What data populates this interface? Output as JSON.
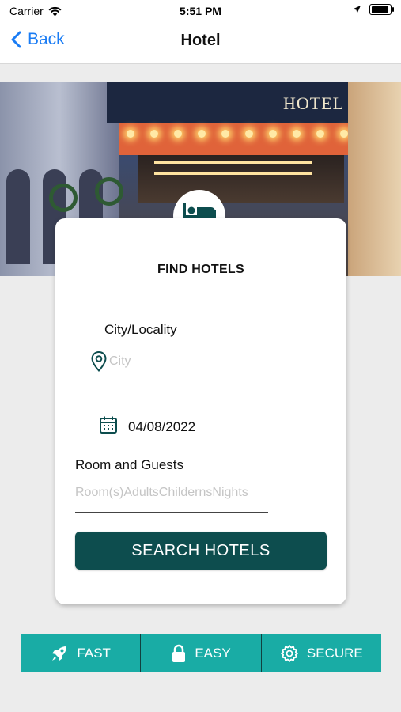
{
  "status_bar": {
    "carrier": "Carrier",
    "time": "5:51 PM"
  },
  "nav": {
    "back_label": "Back",
    "title": "Hotel"
  },
  "hero": {
    "sign_text": "HOTEL"
  },
  "card": {
    "title": "FIND HOTELS",
    "city_label": "City/Locality",
    "city_placeholder": "City",
    "date_value": "04/08/2022",
    "room_guests_label": "Room and Guests",
    "room_guests_placeholder": "Room(s)AdultsChildernsNights",
    "search_button": "SEARCH HOTELS"
  },
  "features": [
    {
      "label": "FAST",
      "icon": "rocket-icon"
    },
    {
      "label": "EASY",
      "icon": "lock-icon"
    },
    {
      "label": "SECURE",
      "icon": "gear-icon"
    }
  ],
  "colors": {
    "primary": "#0d4d4e",
    "accent": "#19aca5",
    "link": "#1a7cf4",
    "background": "#ececec"
  }
}
